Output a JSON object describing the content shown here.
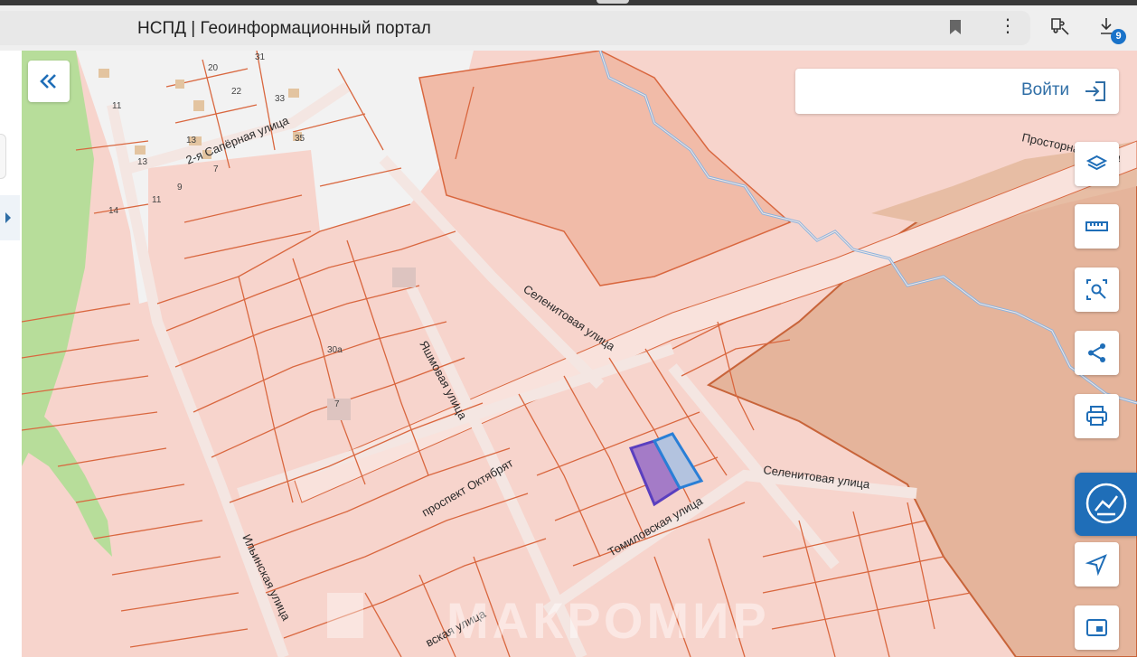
{
  "browser": {
    "tab_title": "НСПД | Геоинформационный портал",
    "downloads_badge": "9"
  },
  "header": {
    "login_label": "Войти"
  },
  "map": {
    "streets": {
      "saper": "2-я Сапёрная улица",
      "selenit_upper": "Селенитовая улица",
      "selenit_lower": "Селенитовая улица",
      "yashm": "Яшмовая улица",
      "oktyabryat": "проспект Октябрят",
      "tomil": "Томиловская улица",
      "ilyin": "Ильинская улица",
      "prostor": "Просторная улица",
      "bottom_partial": "вская улица"
    },
    "house_numbers": [
      "20",
      "31",
      "22",
      "33",
      "11",
      "13",
      "35",
      "13",
      "7",
      "9",
      "11",
      "14",
      "30а",
      "7"
    ],
    "watermark": "МАКРОМИР"
  },
  "tools": {
    "icons": [
      "layers-icon",
      "ruler-icon",
      "search-area-icon",
      "share-icon",
      "print-icon",
      "edit-map-icon",
      "locate-icon",
      "panel-icon"
    ]
  },
  "colors": {
    "parcel_fill": "#f7d4cc",
    "parcel_stroke": "#d9673f",
    "selected_purple": "#a47bc7",
    "selected_blue": "#b3c3df",
    "accent": "#2f6ea6"
  }
}
